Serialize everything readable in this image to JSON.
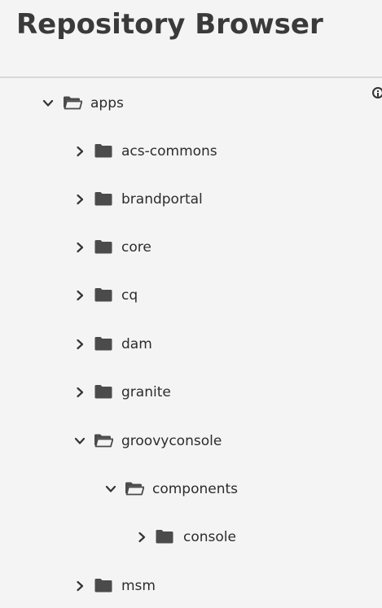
{
  "header": {
    "title": "Repository Browser"
  },
  "tree": {
    "apps": {
      "label": "apps",
      "expanded": true,
      "icon": "folder-open-icon"
    },
    "children": [
      {
        "label": "acs-commons",
        "expanded": false,
        "icon": "folder-icon"
      },
      {
        "label": "brandportal",
        "expanded": false,
        "icon": "folder-icon"
      },
      {
        "label": "core",
        "expanded": false,
        "icon": "folder-icon"
      },
      {
        "label": "cq",
        "expanded": false,
        "icon": "folder-icon"
      },
      {
        "label": "dam",
        "expanded": false,
        "icon": "folder-icon"
      },
      {
        "label": "granite",
        "expanded": false,
        "icon": "folder-icon"
      },
      {
        "label": "groovyconsole",
        "expanded": true,
        "icon": "folder-open-icon"
      },
      {
        "label": "msm",
        "expanded": false,
        "icon": "folder-icon"
      }
    ],
    "groovyconsole_children": [
      {
        "label": "components",
        "expanded": true,
        "icon": "folder-open-icon"
      }
    ],
    "components_children": [
      {
        "label": "console",
        "expanded": false,
        "icon": "folder-icon"
      }
    ]
  },
  "colors": {
    "background": "#f4f4f4",
    "text": "#2c2c2c",
    "icon": "#4b4b4b",
    "divider": "#d8d8d8"
  }
}
